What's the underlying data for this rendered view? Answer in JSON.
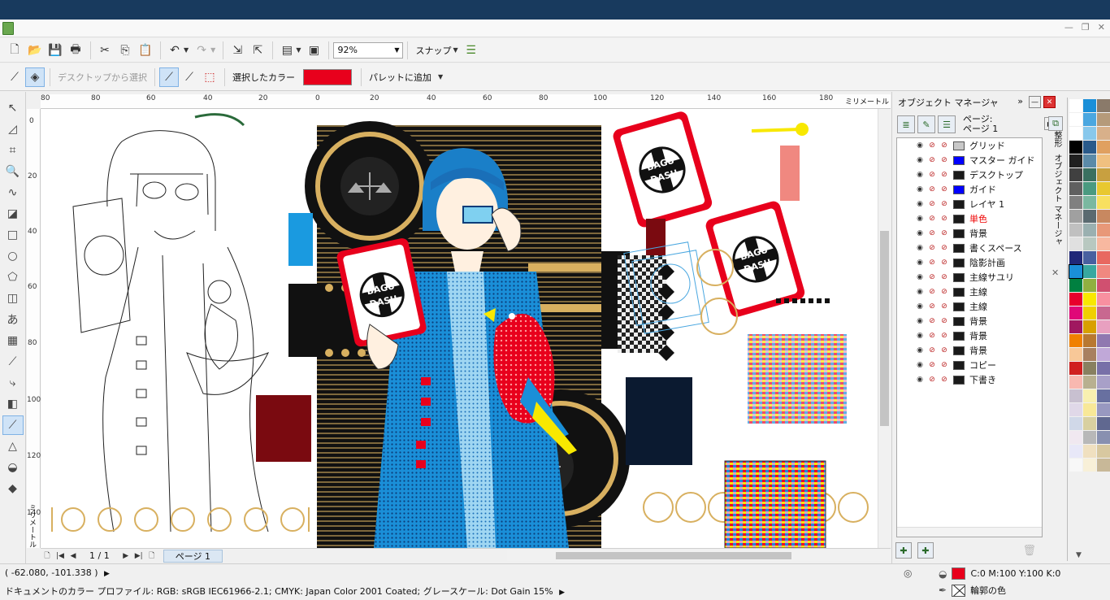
{
  "window": {
    "controls": [
      "—",
      "❐",
      "✕"
    ]
  },
  "toolbar": {
    "zoom_value": "92%",
    "snap_label": "スナップ"
  },
  "propbar": {
    "desktop_pick_label": "デスクトップから選択",
    "selected_color_label": "選択したカラー",
    "selected_color": "#e8001c",
    "add_palette_label": "パレットに追加"
  },
  "ruler": {
    "h_ticks": [
      "80",
      "60",
      "40",
      "20",
      "0",
      "20",
      "40",
      "60",
      "80",
      "100",
      "120",
      "140",
      "160",
      "180"
    ],
    "h_unit": "ミリメートル",
    "v_ticks": [
      "0",
      "20",
      "40",
      "60",
      "80",
      "100",
      "120",
      "140"
    ],
    "v_unit": "ミリメートル"
  },
  "pagebar": {
    "page_count": "1 / 1",
    "page_tab": "ページ 1"
  },
  "object_manager": {
    "title": "オブジェクト マネージャ",
    "page_label_line1": "ページ:",
    "page_label_line2": "ページ 1",
    "layers": [
      {
        "name": "グリッド",
        "color": "#c8c8c8",
        "red": false
      },
      {
        "name": "マスター ガイド",
        "color": "#0000ff",
        "red": false
      },
      {
        "name": "デスクトップ",
        "color": "#1a1a1a",
        "red": false
      },
      {
        "name": "ガイド",
        "color": "#0000ff",
        "red": false
      },
      {
        "name": "レイヤ 1",
        "color": "#1a1a1a",
        "red": false
      },
      {
        "name": "単色",
        "color": "#1a1a1a",
        "red": true
      },
      {
        "name": "背景",
        "color": "#1a1a1a",
        "red": false
      },
      {
        "name": "書くスペース",
        "color": "#1a1a1a",
        "red": false
      },
      {
        "name": "陰影計画",
        "color": "#1a1a1a",
        "red": false
      },
      {
        "name": "主線サユリ",
        "color": "#1a1a1a",
        "red": false
      },
      {
        "name": "主線",
        "color": "#1a1a1a",
        "red": false
      },
      {
        "name": "主線",
        "color": "#1a1a1a",
        "red": false
      },
      {
        "name": "背景",
        "color": "#1a1a1a",
        "red": false
      },
      {
        "name": "背景",
        "color": "#1a1a1a",
        "red": false
      },
      {
        "name": "背景",
        "color": "#1a1a1a",
        "red": false
      },
      {
        "name": "コピー",
        "color": "#1a1a1a",
        "red": false
      },
      {
        "name": "下書き",
        "color": "#1a1a1a",
        "red": false
      }
    ],
    "side_tab_1": "整形",
    "side_tab_2": "オブジェクト マネージャ"
  },
  "card": {
    "line1": "BAGU",
    "line2": "DASU"
  },
  "palette": {
    "colors": [
      "#ffffff",
      "#1a8fd8",
      "#8a7a6a",
      "#ffffff",
      "#4aa7e0",
      "#b59a7a",
      "#ffffff",
      "#88c8ec",
      "#d8b08a",
      "#000000",
      "#2a5a8a",
      "#e0a060",
      "#202020",
      "#5a8aa8",
      "#f0c080",
      "#404040",
      "#3a7060",
      "#c8a040",
      "#606060",
      "#4a9a80",
      "#e8c830",
      "#808080",
      "#7ab8a0",
      "#f8e060",
      "#a0a0a0",
      "#5a6a70",
      "#c88860",
      "#c0c0c0",
      "#9ab0b0",
      "#e89878",
      "#e0e0e0",
      "#b8c8c0",
      "#f8b8a0",
      "#202878",
      "#4860a0",
      "#e86860",
      "#1a8fd8",
      "#38a8a0",
      "#f08880",
      "#008040",
      "#90b040",
      "#d05070",
      "#e8002c",
      "#f8e800",
      "#f890a0",
      "#e00878",
      "#f0d000",
      "#c86890",
      "#a01860",
      "#d8a000",
      "#e8a0c0",
      "#f08000",
      "#b87830",
      "#9078b0",
      "#f8c898",
      "#a88060",
      "#c0a8d8",
      "#d02020",
      "#888060",
      "#7870a8",
      "#f8b8b0",
      "#b8b090",
      "#a8a0c8",
      "#c8c0d0",
      "#f8f0b0",
      "#6870a0",
      "#e0d8e8",
      "#f8e898",
      "#9898c0",
      "#d0d8e8",
      "#d8d0a0",
      "#606890",
      "#f0e8f0",
      "#b8b8b8",
      "#8890b0",
      "#e8e8f8",
      "#f0e0c0",
      "#d8c8a0",
      "#f8f8f8",
      "#f8f0d8",
      "#c8b898"
    ],
    "bottom_caret": "▼"
  },
  "status": {
    "coords": "( -62.080, -101.338 )",
    "profile": "ドキュメントのカラー プロファイル: RGB: sRGB IEC61966-2.1; CMYK: Japan Color 2001 Coated; グレースケール: Dot Gain 15%",
    "fill_text": "C:0 M:100 Y:100 K:0",
    "fill_color": "#e8001c",
    "outline_text": "輪郭の色"
  }
}
